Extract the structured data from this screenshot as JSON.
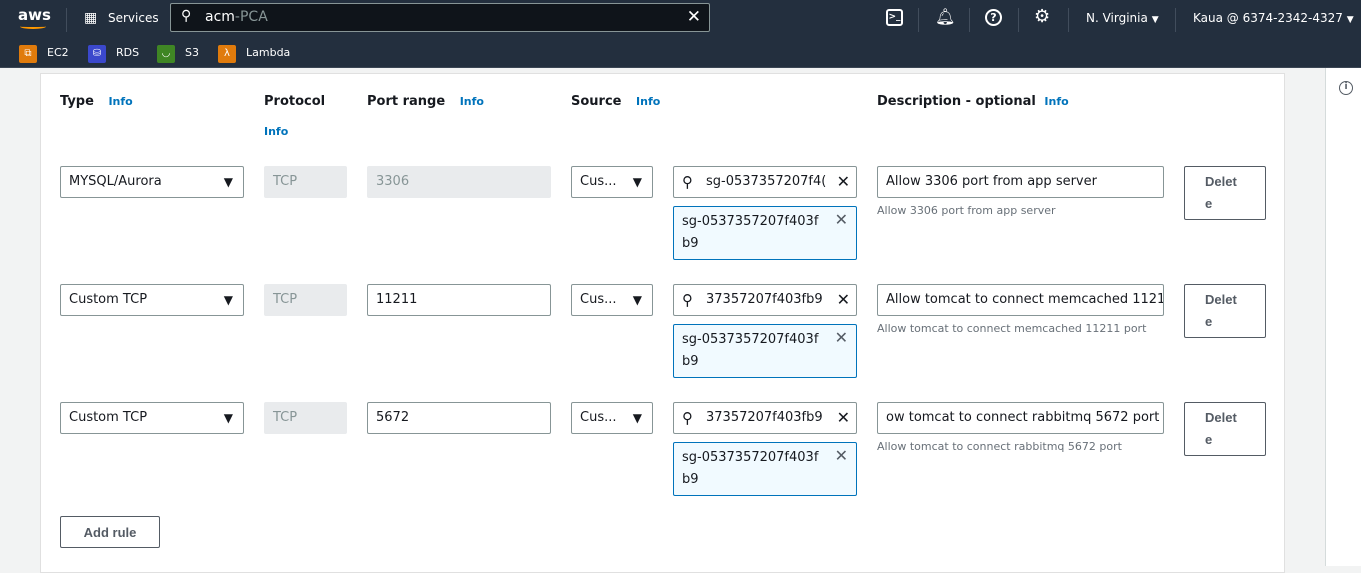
{
  "header": {
    "logo": "aws",
    "services": "Services",
    "search_value": "acm",
    "search_suffix": "-PCA",
    "region": "N. Virginia",
    "account": "Kaua @ 6374-2342-4327"
  },
  "favorites": [
    {
      "label": "EC2",
      "color": "#e07b0c"
    },
    {
      "label": "RDS",
      "color": "#3b48cc"
    },
    {
      "label": "S3",
      "color": "#3f8624"
    },
    {
      "label": "Lambda",
      "color": "#e07b0c"
    }
  ],
  "columns": {
    "type": "Type",
    "protocol": "Protocol",
    "port": "Port range",
    "source": "Source",
    "description": "Description - optional",
    "info": "Info"
  },
  "rules": [
    {
      "type": "MYSQL/Aurora",
      "protocol": "TCP",
      "port": "3306",
      "port_disabled": true,
      "source": "Cus...",
      "sg_search": "sg-0537357207f4(",
      "sg_token": "sg-0537357207f403f",
      "sg_token2": "b9",
      "description": "Allow 3306 port from app server",
      "hint": "Allow 3306 port from app server"
    },
    {
      "type": "Custom TCP",
      "protocol": "TCP",
      "port": "11211",
      "port_disabled": false,
      "source": "Cus...",
      "sg_search": "37357207f403fb9",
      "sg_token": "sg-0537357207f403f",
      "sg_token2": "b9",
      "description": "Allow tomcat to connect memcached 1121",
      "hint": "Allow tomcat to connect memcached 11211 port"
    },
    {
      "type": "Custom TCP",
      "protocol": "TCP",
      "port": "5672",
      "port_disabled": false,
      "source": "Cus...",
      "sg_search": "37357207f403fb9",
      "sg_token": "sg-0537357207f403f",
      "sg_token2": "b9",
      "description": "ow tomcat to connect rabbitmq 5672 port",
      "hint": "Allow tomcat to connect rabbitmq 5672 port"
    }
  ],
  "delete_label_1": "Delet",
  "delete_label_2": "e",
  "add_rule": "Add rule"
}
